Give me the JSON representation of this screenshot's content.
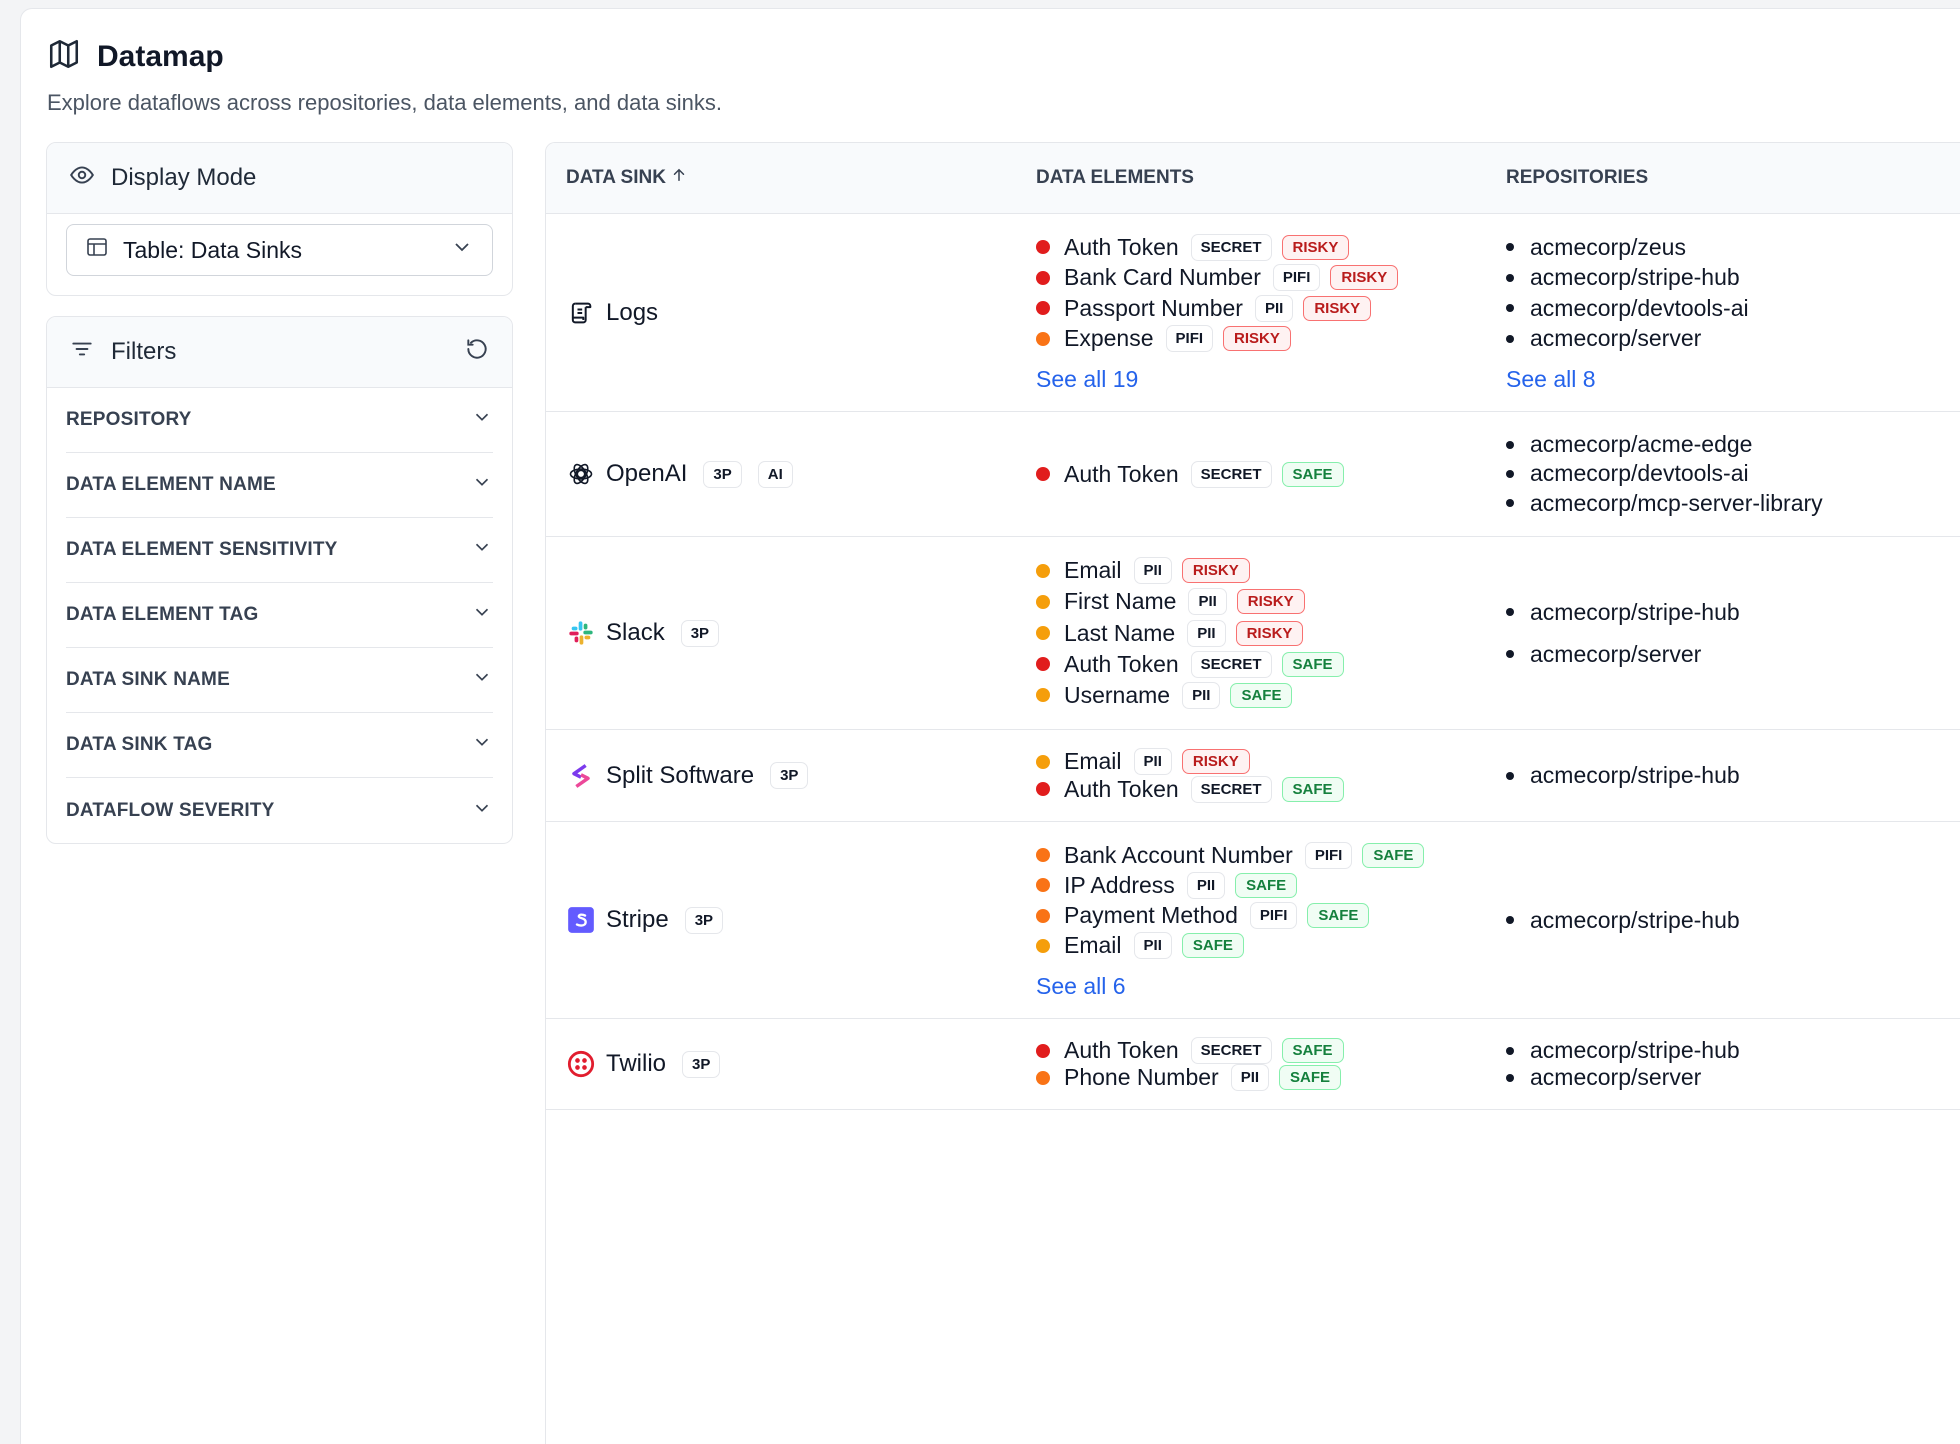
{
  "header": {
    "title": "Datamap",
    "subtitle": "Explore dataflows across repositories, data elements, and data sinks."
  },
  "display_mode": {
    "label": "Display Mode",
    "selected": "Table: Data Sinks"
  },
  "filters": {
    "label": "Filters",
    "items": [
      "REPOSITORY",
      "DATA ELEMENT NAME",
      "DATA ELEMENT SENSITIVITY",
      "DATA ELEMENT TAG",
      "DATA SINK NAME",
      "DATA SINK TAG",
      "DATAFLOW SEVERITY"
    ]
  },
  "table": {
    "columns": [
      "DATA SINK",
      "DATA ELEMENTS",
      "REPOSITORIES"
    ],
    "rows": [
      {
        "sink": "Logs",
        "icon": "scroll-icon",
        "chips": [],
        "elements": [
          {
            "name": "Auth Token",
            "tag": "SECRET",
            "status": "RISKY",
            "dot": "#e11d1d"
          },
          {
            "name": "Bank Card Number",
            "tag": "PIFI",
            "status": "RISKY",
            "dot": "#e11d1d"
          },
          {
            "name": "Passport Number",
            "tag": "PII",
            "status": "RISKY",
            "dot": "#e11d1d"
          },
          {
            "name": "Expense",
            "tag": "PIFI",
            "status": "RISKY",
            "dot": "#f97316"
          }
        ],
        "elements_see_all": "See all 19",
        "repos": [
          "acmecorp/zeus",
          "acmecorp/stripe-hub",
          "acmecorp/devtools-ai",
          "acmecorp/server"
        ],
        "repos_see_all": "See all 8"
      },
      {
        "sink": "OpenAI",
        "icon": "openai-icon",
        "chips": [
          "3P",
          "AI"
        ],
        "elements": [
          {
            "name": "Auth Token",
            "tag": "SECRET",
            "status": "SAFE",
            "dot": "#e11d1d"
          }
        ],
        "elements_see_all": "",
        "repos": [
          "acmecorp/acme-edge",
          "acmecorp/devtools-ai",
          "acmecorp/mcp-server-library"
        ],
        "repos_see_all": ""
      },
      {
        "sink": "Slack",
        "icon": "slack-icon",
        "chips": [
          "3P"
        ],
        "elements": [
          {
            "name": "Email",
            "tag": "PII",
            "status": "RISKY",
            "dot": "#f59e0b"
          },
          {
            "name": "First Name",
            "tag": "PII",
            "status": "RISKY",
            "dot": "#f59e0b"
          },
          {
            "name": "Last Name",
            "tag": "PII",
            "status": "RISKY",
            "dot": "#f59e0b"
          },
          {
            "name": "Auth Token",
            "tag": "SECRET",
            "status": "SAFE",
            "dot": "#e11d1d"
          },
          {
            "name": "Username",
            "tag": "PII",
            "status": "SAFE",
            "dot": "#f59e0b"
          }
        ],
        "elements_see_all": "",
        "repos": [
          "acmecorp/stripe-hub",
          "acmecorp/server"
        ],
        "repos_see_all": ""
      },
      {
        "sink": "Split Software",
        "icon": "split-icon",
        "chips": [
          "3P"
        ],
        "elements": [
          {
            "name": "Email",
            "tag": "PII",
            "status": "RISKY",
            "dot": "#f59e0b"
          },
          {
            "name": "Auth Token",
            "tag": "SECRET",
            "status": "SAFE",
            "dot": "#e11d1d"
          }
        ],
        "elements_see_all": "",
        "repos": [
          "acmecorp/stripe-hub"
        ],
        "repos_see_all": ""
      },
      {
        "sink": "Stripe",
        "icon": "stripe-icon",
        "chips": [
          "3P"
        ],
        "elements": [
          {
            "name": "Bank Account Number",
            "tag": "PIFI",
            "status": "SAFE",
            "dot": "#f97316"
          },
          {
            "name": "IP Address",
            "tag": "PII",
            "status": "SAFE",
            "dot": "#f97316"
          },
          {
            "name": "Payment Method",
            "tag": "PIFI",
            "status": "SAFE",
            "dot": "#f97316"
          },
          {
            "name": "Email",
            "tag": "PII",
            "status": "SAFE",
            "dot": "#f59e0b"
          }
        ],
        "elements_see_all": "See all 6",
        "repos": [
          "acmecorp/stripe-hub"
        ],
        "repos_see_all": ""
      },
      {
        "sink": "Twilio",
        "icon": "twilio-icon",
        "chips": [
          "3P"
        ],
        "elements": [
          {
            "name": "Auth Token",
            "tag": "SECRET",
            "status": "SAFE",
            "dot": "#e11d1d"
          },
          {
            "name": "Phone Number",
            "tag": "PII",
            "status": "SAFE",
            "dot": "#f97316"
          }
        ],
        "elements_see_all": "",
        "repos": [
          "acmecorp/stripe-hub",
          "acmecorp/server"
        ],
        "repos_see_all": ""
      }
    ]
  }
}
